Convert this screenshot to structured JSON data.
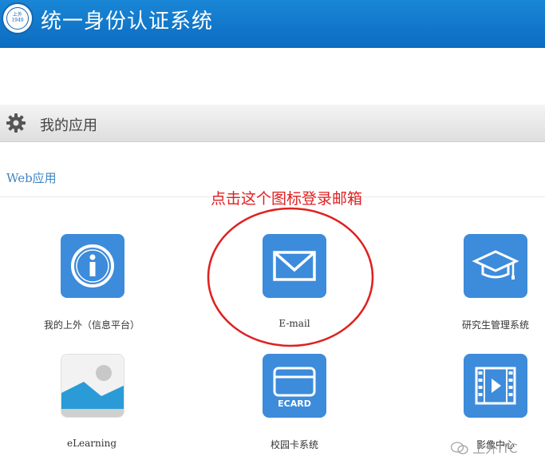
{
  "header": {
    "title": "统一身份认证系统",
    "logo_text": [
      "上外",
      "1949"
    ]
  },
  "section": {
    "title": "我的应用"
  },
  "subsection": {
    "title": "Web应用"
  },
  "annotation": {
    "text": "点击这个图标登录邮箱",
    "color": "#e02020"
  },
  "apps": [
    {
      "label": "我的上外（信息平台）",
      "icon": "info-icon"
    },
    {
      "label": "E-mail",
      "icon": "envelope-icon"
    },
    {
      "label": "研究生管理系统",
      "icon": "graduation-cap-icon"
    },
    {
      "label": "eLearning",
      "icon": "image-icon"
    },
    {
      "label": "校园卡系统",
      "icon": "card-icon",
      "icon_text": "ECARD"
    },
    {
      "label": "影像中心",
      "icon": "film-play-icon"
    }
  ],
  "watermark": {
    "text": "上外ITC"
  },
  "colors": {
    "header": "#0b6cc0",
    "tile": "#3d8bdb",
    "link": "#3e86c4"
  }
}
